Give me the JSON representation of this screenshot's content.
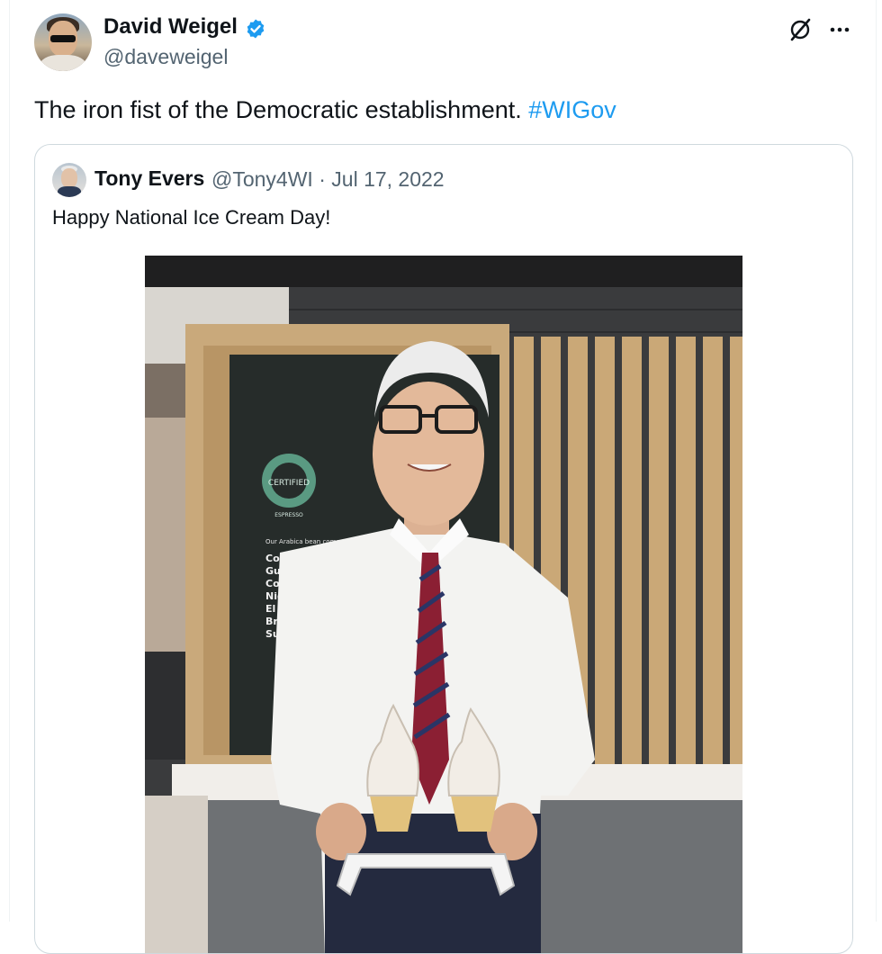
{
  "tweet": {
    "author_name": "David Weigel",
    "author_handle": "@daveweigel",
    "text": "The iron fist of the Democratic establishment. ",
    "hashtag": "#WIGov"
  },
  "quote": {
    "author_name": "Tony Evers",
    "author_handle": "@Tony4WI",
    "separator": "·",
    "date": "Jul 17, 2022",
    "text": "Happy National Ice Cream Day!"
  },
  "sign": {
    "badge": "CERTIFIED",
    "badge_sub": "ESPRESSO",
    "heading": "Our Arabica bean comes from re",
    "origins": [
      "Colom",
      "Guate",
      "Costa",
      "Nica",
      "El S",
      "Bra",
      "Sur"
    ]
  },
  "colors": {
    "link": "#1d9bf0",
    "verified": "#1d9bf0",
    "muted": "#536471"
  }
}
